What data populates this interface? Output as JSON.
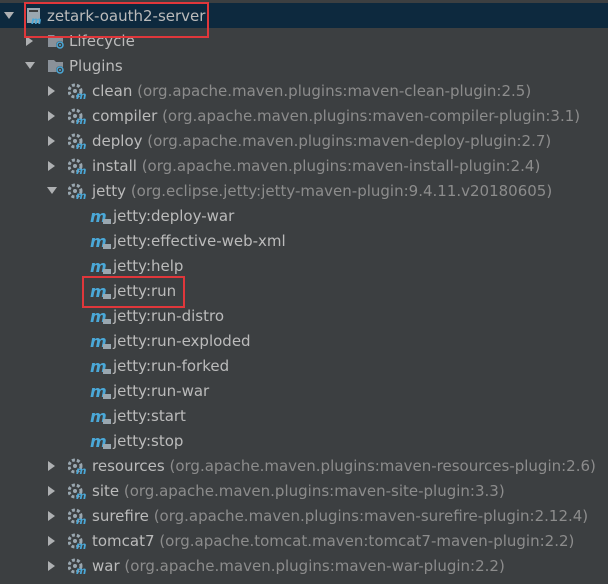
{
  "root": {
    "label": "zetark-oauth2-server"
  },
  "lifecycle": {
    "label": "Lifecycle"
  },
  "plugins": {
    "label": "Plugins",
    "clean": {
      "name": "clean",
      "detail": "(org.apache.maven.plugins:maven-clean-plugin:2.5)"
    },
    "compiler": {
      "name": "compiler",
      "detail": "(org.apache.maven.plugins:maven-compiler-plugin:3.1)"
    },
    "deploy": {
      "name": "deploy",
      "detail": "(org.apache.maven.plugins:maven-deploy-plugin:2.7)"
    },
    "install": {
      "name": "install",
      "detail": "(org.apache.maven.plugins:maven-install-plugin:2.4)"
    },
    "jetty": {
      "name": "jetty",
      "detail": "(org.eclipse.jetty:jetty-maven-plugin:9.4.11.v20180605)",
      "goals": [
        "jetty:deploy-war",
        "jetty:effective-web-xml",
        "jetty:help",
        "jetty:run",
        "jetty:run-distro",
        "jetty:run-exploded",
        "jetty:run-forked",
        "jetty:run-war",
        "jetty:start",
        "jetty:stop"
      ]
    },
    "resources": {
      "name": "resources",
      "detail": "(org.apache.maven.plugins:maven-resources-plugin:2.6)"
    },
    "site": {
      "name": "site",
      "detail": "(org.apache.maven.plugins:maven-site-plugin:3.3)"
    },
    "surefire": {
      "name": "surefire",
      "detail": "(org.apache.maven.plugins:maven-surefire-plugin:2.12.4)"
    },
    "tomcat7": {
      "name": "tomcat7",
      "detail": "(org.apache.tomcat.maven:tomcat7-maven-plugin:2.2)"
    },
    "war": {
      "name": "war",
      "detail": "(org.apache.maven.plugins:maven-war-plugin:2.2)"
    }
  },
  "colors": {
    "background": "#3c3f41",
    "selection": "#0d293e",
    "text": "#bbbbbb",
    "detail_text": "#8c8c8c",
    "annotation": "#e0373b",
    "maven_icon": "#4aa8d8"
  }
}
